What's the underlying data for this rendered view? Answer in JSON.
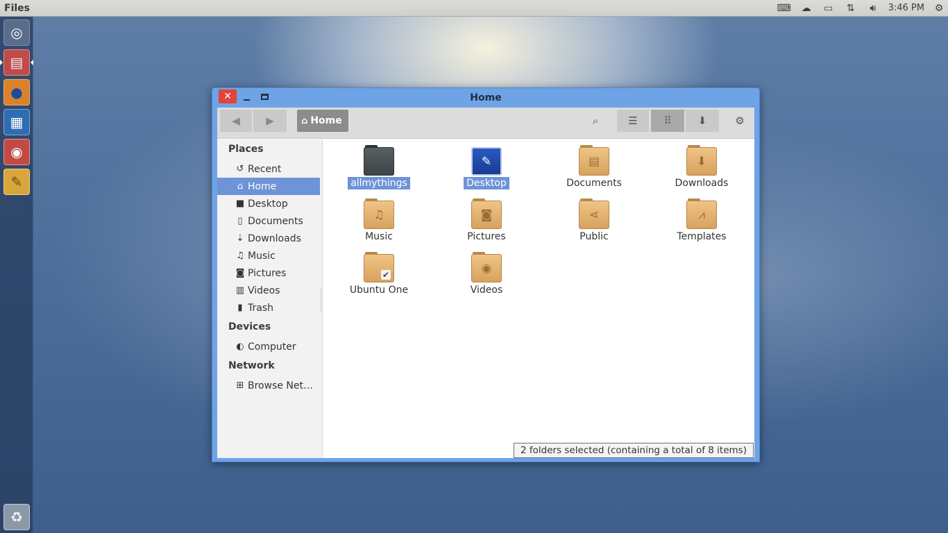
{
  "panel": {
    "app_title": "Files",
    "clock": "3:46 PM"
  },
  "window": {
    "title": "Home",
    "path_home": "Home"
  },
  "sidebar": {
    "places_heading": "Places",
    "places": [
      {
        "label": "Recent",
        "icon": "recent-icon"
      },
      {
        "label": "Home",
        "icon": "home-icon"
      },
      {
        "label": "Desktop",
        "icon": "desktop-icon"
      },
      {
        "label": "Documents",
        "icon": "documents-icon"
      },
      {
        "label": "Downloads",
        "icon": "download-icon"
      },
      {
        "label": "Music",
        "icon": "music-icon"
      },
      {
        "label": "Pictures",
        "icon": "camera-icon"
      },
      {
        "label": "Videos",
        "icon": "film-icon"
      },
      {
        "label": "Trash",
        "icon": "trash-icon"
      }
    ],
    "devices_heading": "Devices",
    "devices": [
      {
        "label": "Computer",
        "icon": "drive-icon"
      }
    ],
    "network_heading": "Network",
    "network": [
      {
        "label": "Browse Net…",
        "icon": "network-icon"
      }
    ]
  },
  "files": [
    {
      "name": "allmythings",
      "selected": true
    },
    {
      "name": "Desktop",
      "selected": true
    },
    {
      "name": "Documents",
      "selected": false
    },
    {
      "name": "Downloads",
      "selected": false
    },
    {
      "name": "Music",
      "selected": false
    },
    {
      "name": "Pictures",
      "selected": false
    },
    {
      "name": "Public",
      "selected": false
    },
    {
      "name": "Templates",
      "selected": false
    },
    {
      "name": "Ubuntu One",
      "selected": false
    },
    {
      "name": "Videos",
      "selected": false
    }
  ],
  "status": "2 folders selected  (containing a total of 8 items)",
  "colors": {
    "selection": "#6e93d6",
    "window_frame": "#6ea3e6",
    "close_button": "#e0443b",
    "folder": "#d8a25d"
  }
}
